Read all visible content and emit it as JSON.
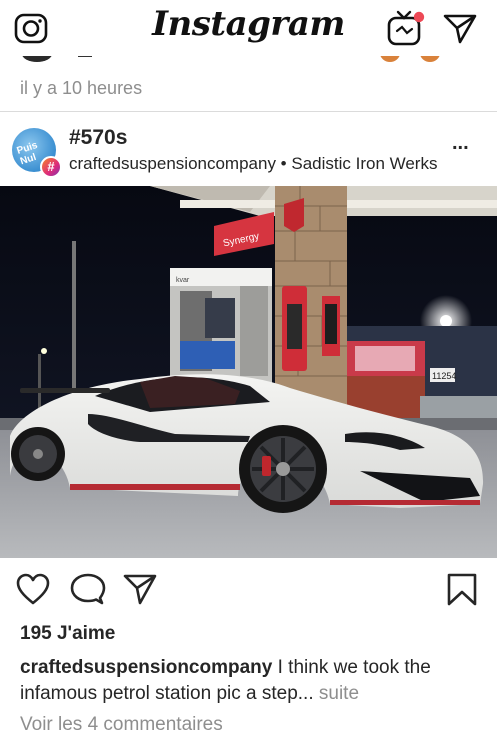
{
  "topbar": {
    "logo": "Instagram",
    "icons": [
      "camera-icon",
      "igtv-icon",
      "direct-message-icon"
    ],
    "notification_dot_color": "#ed4956"
  },
  "previous_post": {
    "timestamp": "il y a 10 heures"
  },
  "post": {
    "title": "#570s",
    "subtitle": "craftedsuspensioncompany • Sadistic Iron Werks",
    "avatar_badge": "#",
    "more_label": "...",
    "photo": {
      "sign_text": "Synergy",
      "pump_label": "kvar",
      "address_number": "11254"
    },
    "likes": "195 J'aime",
    "caption": {
      "username": "craftedsuspensioncompany",
      "text": " I think we took the infamous petrol station pic a step...",
      "more": " suite"
    },
    "view_comments": "Voir les 4 commentaires"
  },
  "colors": {
    "text": "#262626",
    "secondary_text": "#8e8e8e",
    "divider": "#dbdbdb"
  }
}
